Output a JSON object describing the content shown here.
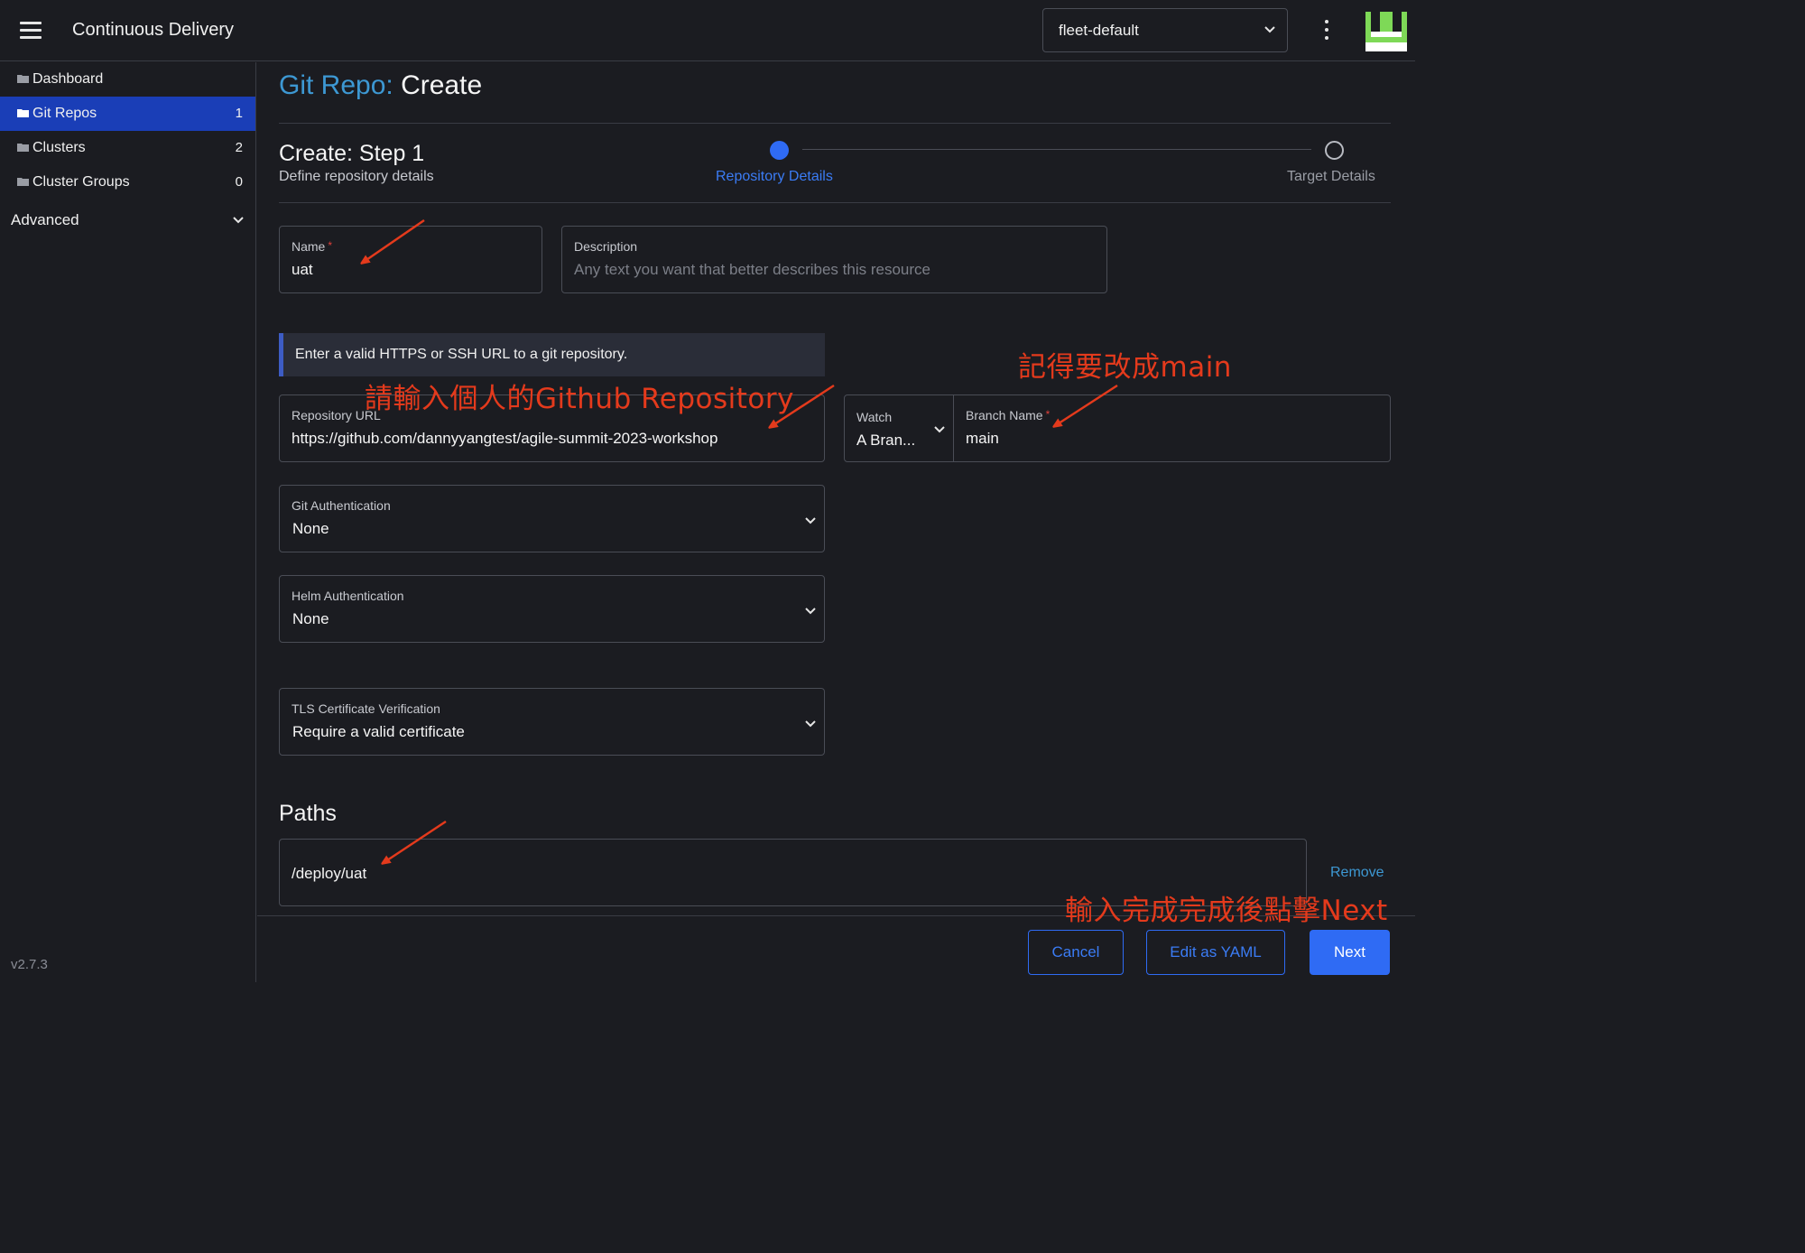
{
  "header": {
    "title": "Continuous Delivery",
    "workspace": "fleet-default"
  },
  "sidebar": {
    "items": [
      {
        "label": "Dashboard",
        "count": ""
      },
      {
        "label": "Git Repos",
        "count": "1"
      },
      {
        "label": "Clusters",
        "count": "2"
      },
      {
        "label": "Cluster Groups",
        "count": "0"
      }
    ],
    "advanced": "Advanced",
    "version": "v2.7.3"
  },
  "page": {
    "crumb": "Git Repo:",
    "action": "Create"
  },
  "wizard": {
    "title": "Create: Step 1",
    "subtitle": "Define repository details",
    "steps": [
      "Repository Details",
      "Target Details"
    ],
    "active_step": 1
  },
  "form": {
    "name": {
      "label": "Name",
      "value": "uat",
      "required": true
    },
    "description": {
      "label": "Description",
      "placeholder": "Any text you want that better describes this resource"
    },
    "url_hint": "Enter a valid HTTPS or SSH URL to a git repository.",
    "repo_url": {
      "label": "Repository URL",
      "value": "https://github.com/dannyyangtest/agile-summit-2023-workshop"
    },
    "watch": {
      "label": "Watch",
      "value": "A Bran..."
    },
    "branch": {
      "label": "Branch Name",
      "value": "main",
      "required": true
    },
    "git_auth": {
      "label": "Git Authentication",
      "value": "None"
    },
    "helm_auth": {
      "label": "Helm Authentication",
      "value": "None"
    },
    "tls": {
      "label": "TLS Certificate Verification",
      "value": "Require a valid certificate"
    },
    "paths_title": "Paths",
    "paths": [
      "/deploy/uat"
    ],
    "remove_label": "Remove"
  },
  "footer": {
    "cancel": "Cancel",
    "edit_yaml": "Edit as YAML",
    "next": "Next"
  },
  "annotations": {
    "repo": "請輸入個人的Github Repository",
    "branch": "記得要改成main",
    "next": "輸入完成完成後點擊Next",
    "color": "#e43a1c"
  },
  "colors": {
    "background": "#1b1c21",
    "accent": "#2f6bf4",
    "link": "#3d98d3",
    "active_nav": "#1a3eb7"
  }
}
